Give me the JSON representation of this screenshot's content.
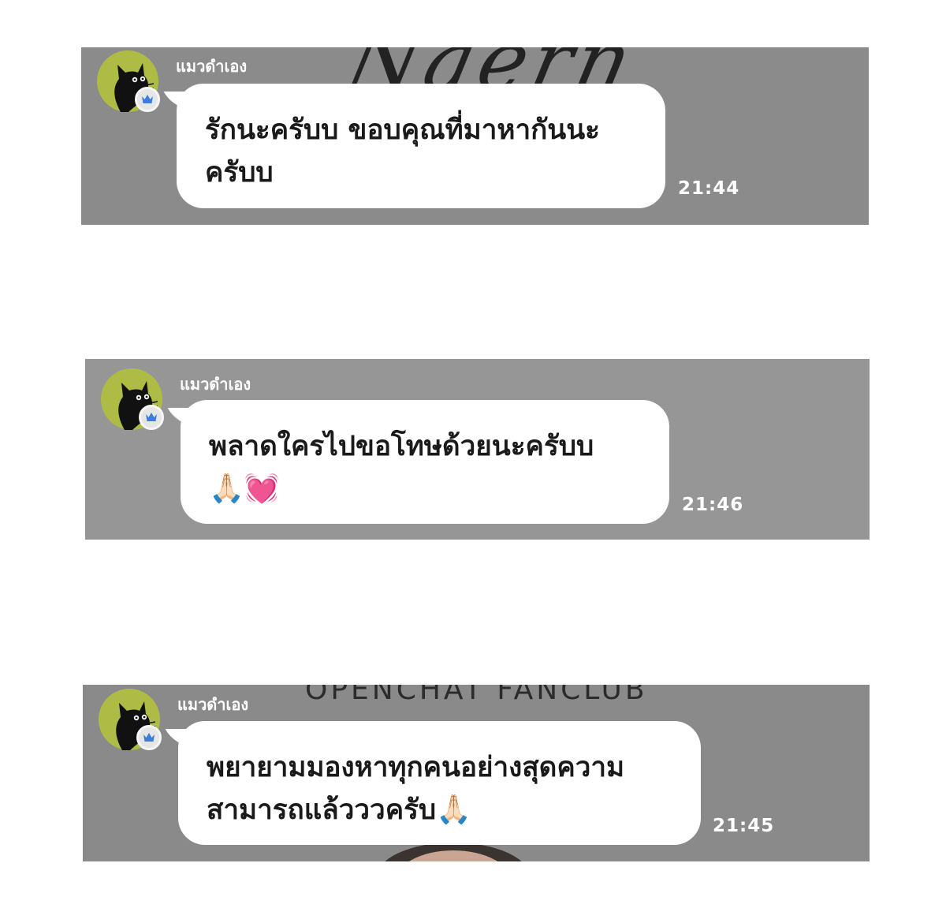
{
  "messages": [
    {
      "sender": "แมวดำเอง",
      "lines": [
        "รักนะครับบ ขอบคุณที่มาหากันนะ",
        "ครับบ"
      ],
      "emoji": "",
      "time": "21:44",
      "background_text": "Naern"
    },
    {
      "sender": "แมวดำเอง",
      "lines": [
        "พลาดใครไปขอโทษด้วยนะครับบ",
        ""
      ],
      "emoji": "🙏🏻💓",
      "time": "21:46",
      "background_text": ""
    },
    {
      "sender": "แมวดำเอง",
      "lines": [
        "พยายามมองหาทุกคนอย่างสุดความ",
        "สามารถแล้ววว"
      ],
      "emoji": "",
      "line2_suffix": "ครับ",
      "line2_emoji": "🙏🏻",
      "time": "21:45",
      "background_text": "OPENCHAT FANCLUB"
    }
  ],
  "colors": {
    "panel_bg": "#8e8e8e",
    "avatar_bg": "#aebc45",
    "crown": "#3b7dd8",
    "bubble": "#ffffff",
    "text": "#1a1a1a"
  },
  "icons": {
    "avatar": "black-cat-icon",
    "badge": "crown-icon"
  }
}
